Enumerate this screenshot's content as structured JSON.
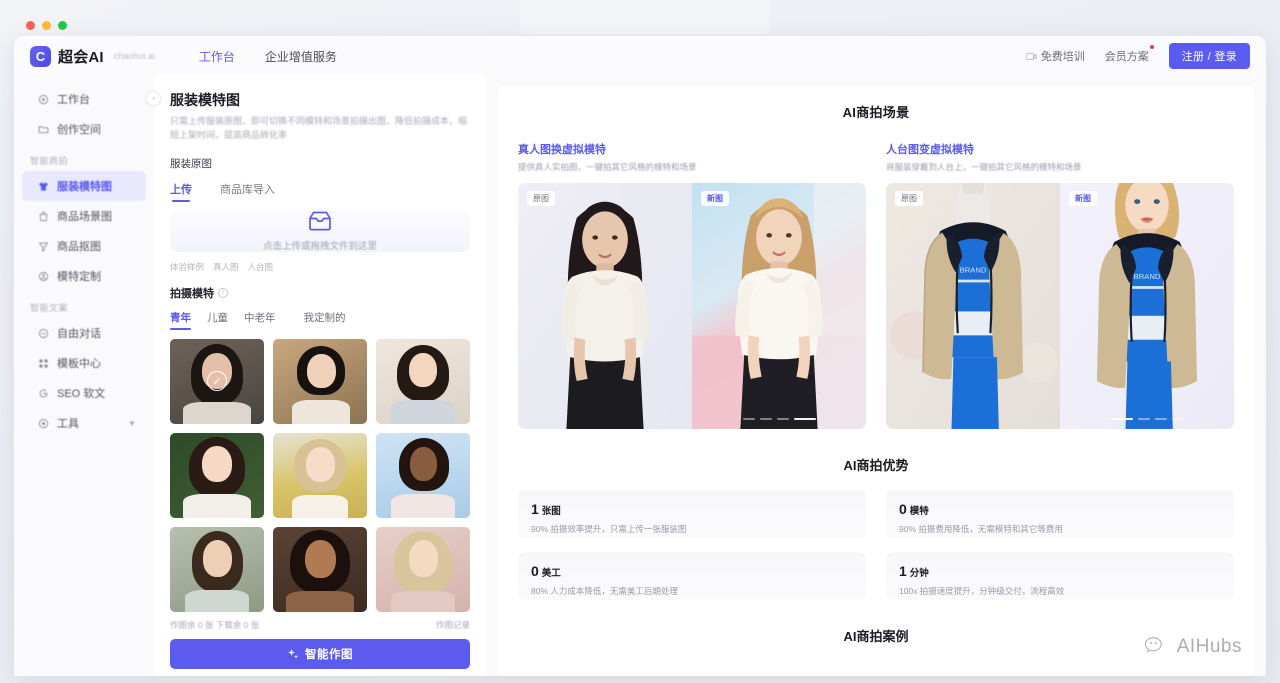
{
  "window": {
    "traffic_lights": [
      "close",
      "minimize",
      "maximize"
    ]
  },
  "header": {
    "brand_name": "超会AI",
    "brand_url": "chaohui.ai",
    "logo_letter": "C",
    "nav": [
      {
        "label": "工作台",
        "active": true
      },
      {
        "label": "企业增值服务",
        "active": false
      }
    ],
    "right": {
      "training": "免费培训",
      "membership": "会员方案",
      "membership_has_badge": true,
      "login_button": "注册 / 登录"
    }
  },
  "sidebar": {
    "items": [
      {
        "label": "工作台",
        "icon": "dashboard-icon",
        "active": false
      },
      {
        "label": "创作空间",
        "icon": "folder-icon",
        "active": false
      }
    ],
    "group1_label": "智能商拍",
    "group1_items": [
      {
        "label": "服装模特图",
        "icon": "shirt-icon",
        "active": true
      },
      {
        "label": "商品场景图",
        "icon": "bag-icon",
        "active": false
      },
      {
        "label": "商品抠图",
        "icon": "cut-icon",
        "active": false
      },
      {
        "label": "模特定制",
        "icon": "person-icon",
        "active": false
      }
    ],
    "group2_label": "智能文案",
    "group2_items": [
      {
        "label": "自由对话",
        "icon": "chat-icon",
        "active": false
      },
      {
        "label": "模板中心",
        "icon": "grid-icon",
        "active": false
      },
      {
        "label": "SEO 软文",
        "icon": "g-icon",
        "active": false
      },
      {
        "label": "工具",
        "icon": "tools-icon",
        "active": false,
        "expandable": true
      }
    ],
    "collapse_toggle": "‹"
  },
  "panel": {
    "title": "服装模特图",
    "description": "只需上传服装原图，即可切换不同模特和场景拍摄出图，降低拍摄成本，缩短上架时间，提高商品转化率",
    "section_label": "服装原图",
    "upload_tabs": [
      {
        "label": "上传",
        "active": true
      },
      {
        "label": "商品库导入",
        "active": false
      }
    ],
    "dropzone_text": "点击上传或拖拽文件到这里",
    "dropzone_icon": "inbox-icon",
    "samples_label": "体验样例",
    "samples": [
      "真人图",
      "人台图"
    ],
    "model_section_title": "拍摄模特",
    "model_info_icon": "info-icon",
    "model_tabs": [
      {
        "label": "青年",
        "active": true
      },
      {
        "label": "儿童",
        "active": false
      },
      {
        "label": "中老年",
        "active": false
      },
      {
        "label": "我定制的",
        "active": false
      }
    ],
    "models": [
      {
        "id": "m1",
        "selected": true,
        "alt": "dark-haired-asian-woman-dark-bg"
      },
      {
        "id": "m2",
        "selected": false,
        "alt": "short-hair-asian-woman-warm-bg"
      },
      {
        "id": "m3",
        "selected": false,
        "alt": "braided-asian-woman-light-bg"
      },
      {
        "id": "m4",
        "selected": false,
        "alt": "red-lips-woman-green-bg"
      },
      {
        "id": "m5",
        "selected": false,
        "alt": "blonde-woman-yellow-field-bg"
      },
      {
        "id": "m6",
        "selected": false,
        "alt": "braided-dark-skin-woman-blue-bg"
      },
      {
        "id": "m7",
        "selected": false,
        "alt": "brunette-woman-outdoor-bg"
      },
      {
        "id": "m8",
        "selected": false,
        "alt": "south-asian-woman-dark-bg"
      },
      {
        "id": "m9",
        "selected": false,
        "alt": "blonde-woman-pink-bg"
      }
    ],
    "quota_text": "作图余 0 张  下载余 0 张",
    "history_link": "作图记录",
    "generate_button": "智能作图",
    "generate_icon": "sparkle-icon"
  },
  "content": {
    "scene_title": "AI商拍场景",
    "scenes": [
      {
        "heading": "真人图换虚拟模特",
        "subtitle": "提供真人实拍图，一键拍其它风格的模特和场景",
        "before_badge": "原图",
        "after_badge": "新图",
        "before_alt": "asian-woman-white-sweater-black-skirt-studio",
        "after_alt": "blonde-woman-white-sweater-black-skirt-pink-scene",
        "carousel_slides": 4,
        "carousel_active": 3
      },
      {
        "heading": "人台图变虚拟模特",
        "subtitle": "将服装穿戴到人台上，一键拍其它风格的模特和场景",
        "before_badge": "原图",
        "after_badge": "新图",
        "before_alt": "mannequin-tan-trench-blue-top",
        "after_alt": "blonde-model-tan-trench-blue-top",
        "carousel_slides": 4,
        "carousel_active": 0
      }
    ],
    "advantage_title": "AI商拍优势",
    "advantages": [
      {
        "number": "1",
        "unit": "张图",
        "desc": "90% 拍摄效率提升，只需上传一张服装图"
      },
      {
        "number": "0",
        "unit": "模特",
        "desc": "90% 拍摄费用降低，无需模特和其它等费用"
      },
      {
        "number": "0",
        "unit": "美工",
        "desc": "80% 人力成本降低，无需美工后期处理"
      },
      {
        "number": "1",
        "unit": "分钟",
        "desc": "100x 拍摄速度提升，分钟级交付，流程高效"
      }
    ],
    "case_title": "AI商拍案例"
  },
  "watermark": {
    "text": "AIHubs",
    "icon": "wechat-icon"
  },
  "colors": {
    "accent": "#5b5bf0",
    "accent_soft": "#e9e9fe",
    "text_primary": "#1c1c26",
    "text_muted": "#9a9aa8",
    "badge_red": "#f5333f",
    "app_bg": "#fafafc"
  }
}
